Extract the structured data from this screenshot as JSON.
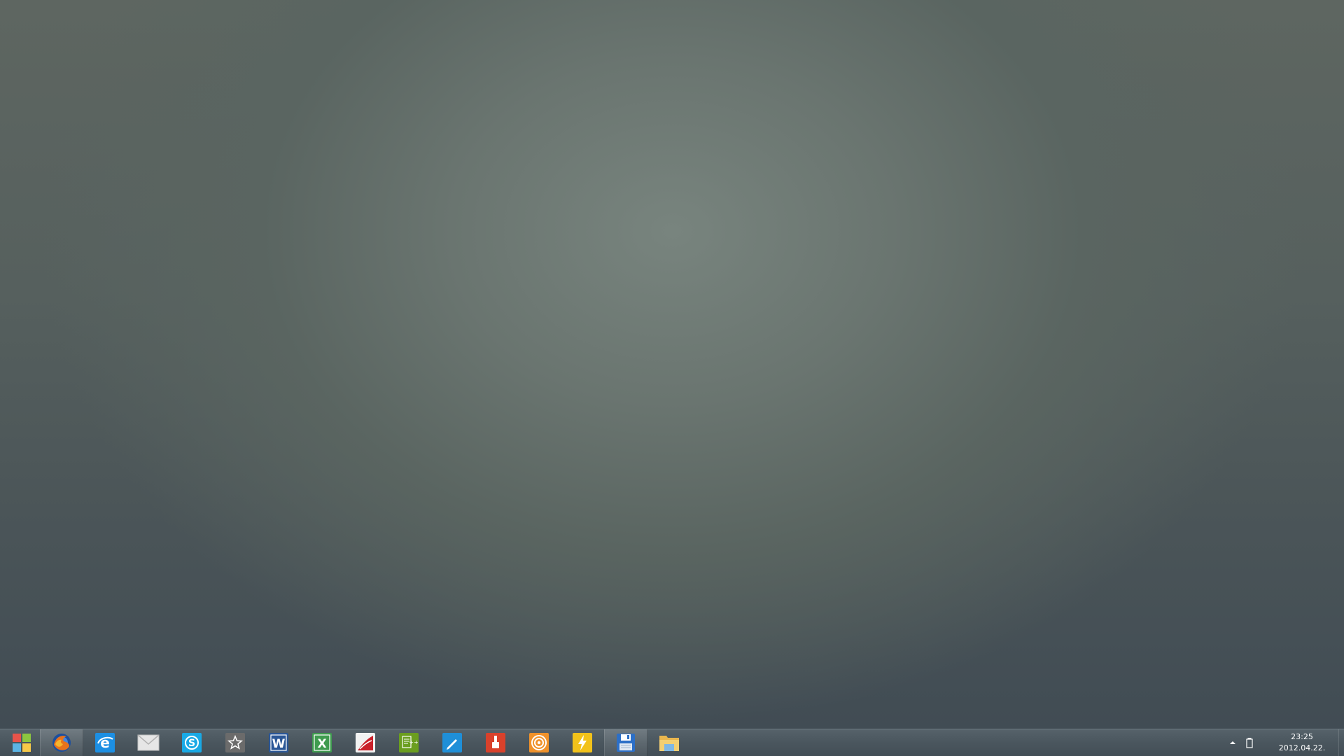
{
  "taskbar": {
    "pinned_apps": [
      {
        "name": "start-button",
        "icon": "windows-logo-icon",
        "active": false
      },
      {
        "name": "firefox",
        "icon": "firefox-icon",
        "active": true
      },
      {
        "name": "internet-explorer",
        "icon": "internet-explorer-icon",
        "active": false
      },
      {
        "name": "mail",
        "icon": "envelope-icon",
        "active": false
      },
      {
        "name": "skype",
        "icon": "skype-icon",
        "active": false
      },
      {
        "name": "favorites",
        "icon": "star-icon",
        "active": false
      },
      {
        "name": "word",
        "icon": "word-icon",
        "active": false
      },
      {
        "name": "excel",
        "icon": "excel-icon",
        "active": false
      },
      {
        "name": "acrobat",
        "icon": "acrobat-icon",
        "active": false
      },
      {
        "name": "notepad-plus",
        "icon": "notepad-plus-icon",
        "active": false
      },
      {
        "name": "paint-editor",
        "icon": "pencil-icon",
        "active": false
      },
      {
        "name": "paint-brush",
        "icon": "paint-brush-icon",
        "active": false
      },
      {
        "name": "target-app",
        "icon": "target-icon",
        "active": false
      },
      {
        "name": "flash-app",
        "icon": "lightning-icon",
        "active": false
      },
      {
        "name": "save-app",
        "icon": "floppy-disk-icon",
        "active": true
      },
      {
        "name": "file-explorer",
        "icon": "folder-icon",
        "active": false
      }
    ],
    "tray": {
      "clock_time": "23:25",
      "clock_date": "2012.04.22."
    }
  },
  "colors": {
    "start_red": "#e8534a",
    "start_green": "#8cc63f",
    "start_blue": "#5bb4e5",
    "start_yellow": "#f7c948",
    "word_blue": "#2b5797",
    "excel_green": "#3f9b4f",
    "skype_blue": "#19a9e5",
    "notepad_green": "#6b9e1f",
    "pencil_blue": "#1f8fd8",
    "brush_red": "#d9412b",
    "target_orange": "#f0922b",
    "flash_yellow": "#f2c21a",
    "floppy_blue": "#2c6fc7",
    "folder_yellow": "#e9b64e"
  }
}
